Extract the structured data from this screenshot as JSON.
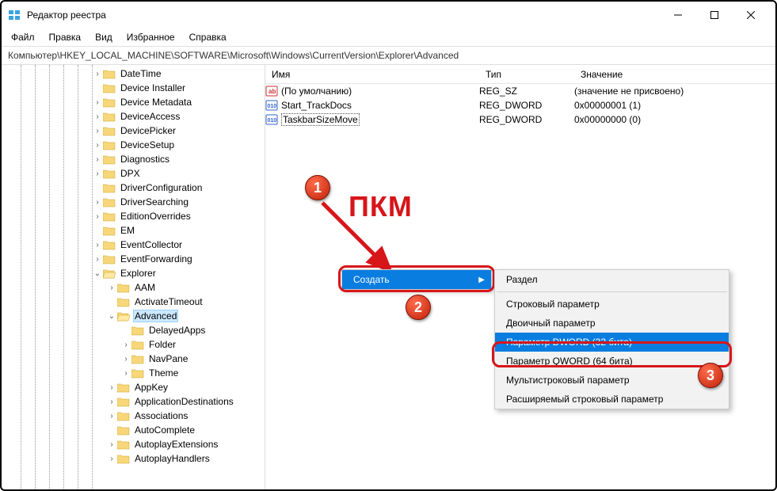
{
  "title": "Редактор реестра",
  "menu": {
    "file": "Файл",
    "edit": "Правка",
    "view": "Вид",
    "fav": "Избранное",
    "help": "Справка"
  },
  "path": "Компьютер\\HKEY_LOCAL_MACHINE\\SOFTWARE\\Microsoft\\Windows\\CurrentVersion\\Explorer\\Advanced",
  "headers": {
    "name": "Имя",
    "type": "Тип",
    "value": "Значение"
  },
  "values": [
    {
      "name": "(По умолчанию)",
      "type": "REG_SZ",
      "data": "(значение не присвоено)",
      "kind": "sz"
    },
    {
      "name": "Start_TrackDocs",
      "type": "REG_DWORD",
      "data": "0x00000001 (1)",
      "kind": "dw"
    },
    {
      "name": "TaskbarSizeMove",
      "type": "REG_DWORD",
      "data": "0x00000000 (0)",
      "kind": "dw",
      "selected": true
    }
  ],
  "tree": [
    {
      "d": 6,
      "label": "DateTime",
      "chev": ">"
    },
    {
      "d": 6,
      "label": "Device Installer"
    },
    {
      "d": 6,
      "label": "Device Metadata",
      "chev": ">"
    },
    {
      "d": 6,
      "label": "DeviceAccess",
      "chev": ">"
    },
    {
      "d": 6,
      "label": "DevicePicker",
      "chev": ">"
    },
    {
      "d": 6,
      "label": "DeviceSetup",
      "chev": ">"
    },
    {
      "d": 6,
      "label": "Diagnostics",
      "chev": ">"
    },
    {
      "d": 6,
      "label": "DPX",
      "chev": ">"
    },
    {
      "d": 6,
      "label": "DriverConfiguration"
    },
    {
      "d": 6,
      "label": "DriverSearching",
      "chev": ">"
    },
    {
      "d": 6,
      "label": "EditionOverrides",
      "chev": ">"
    },
    {
      "d": 6,
      "label": "EM"
    },
    {
      "d": 6,
      "label": "EventCollector",
      "chev": ">"
    },
    {
      "d": 6,
      "label": "EventForwarding",
      "chev": ">"
    },
    {
      "d": 6,
      "label": "Explorer",
      "chev": "v",
      "open": true
    },
    {
      "d": 7,
      "label": "AAM",
      "chev": ">"
    },
    {
      "d": 7,
      "label": "ActivateTimeout"
    },
    {
      "d": 7,
      "label": "Advanced",
      "chev": "v",
      "open": true,
      "selected": true
    },
    {
      "d": 8,
      "label": "DelayedApps"
    },
    {
      "d": 8,
      "label": "Folder",
      "chev": ">"
    },
    {
      "d": 8,
      "label": "NavPane",
      "chev": ">"
    },
    {
      "d": 8,
      "label": "Theme",
      "chev": ">"
    },
    {
      "d": 7,
      "label": "AppKey",
      "chev": ">"
    },
    {
      "d": 7,
      "label": "ApplicationDestinations",
      "chev": ">"
    },
    {
      "d": 7,
      "label": "Associations",
      "chev": ">"
    },
    {
      "d": 7,
      "label": "AutoComplete"
    },
    {
      "d": 7,
      "label": "AutoplayExtensions",
      "chev": ">"
    },
    {
      "d": 7,
      "label": "AutoplayHandlers",
      "chev": ">"
    }
  ],
  "ctx1": {
    "create": "Создать"
  },
  "ctx2": {
    "key": "Раздел",
    "string": "Строковый параметр",
    "binary": "Двоичный параметр",
    "dword": "Параметр DWORD (32 бита)",
    "qword": "Параметр QWORD (64 бита)",
    "multi": "Мультистроковый параметр",
    "expand": "Расширяемый строковый параметр"
  },
  "annot": {
    "rmb": "ПКМ",
    "b1": "1",
    "b2": "2",
    "b3": "3"
  }
}
